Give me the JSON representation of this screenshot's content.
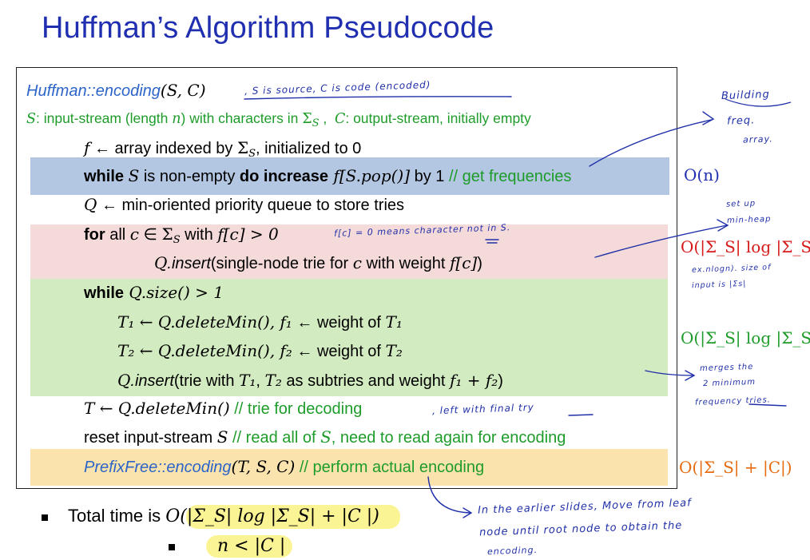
{
  "title": "Huffman’s Algorithm  Pseudocode",
  "code": {
    "header": {
      "name": "Huffman::encoding",
      "args": "(S, C)"
    },
    "params": {
      "s_label": "S",
      "s_desc_1": ": input-stream (length ",
      "n": "n",
      "s_desc_2": ") with characters in ",
      "sigma": "Σ",
      "sub_s": "S",
      "c_label": "C",
      "c_desc": ": output-stream, initially empty"
    },
    "line1": {
      "f": "f",
      "rest": " ← array indexed by ",
      "sigma": "Σ",
      "sub": "S",
      "tail": " initialized to 0"
    },
    "line2": {
      "kw1": "while",
      "S": "S",
      "mid": "  is non-empty ",
      "kw2": "do increase",
      "expr": " f[S.pop()]",
      "tail": " by 1 ",
      "comment": "// get frequencies"
    },
    "line3": {
      "Q": "Q",
      "rest": "  ← min-oriented priority queue to store tries"
    },
    "line4": {
      "kw": "for",
      "rest1": " all ",
      "c": "c",
      "in": "  ∈ ",
      "sigma": "Σ",
      "sub": "S",
      "with": " with ",
      "cond": "f[c] > 0"
    },
    "line5": {
      "Q": "Q",
      "method": ".insert",
      "rest": "(single-node trie for ",
      "c": "c",
      "rest2": " with weight ",
      "fc": "f[c]",
      "close": ")"
    },
    "line6": {
      "kw": "while",
      "expr": " Q.size() > 1"
    },
    "line7": {
      "lhs": "T₁ ← Q.deleteMin(), f₁",
      "rest": " ← weight of  ",
      "t": "T₁"
    },
    "line8": {
      "lhs": "T₂ ← Q.deleteMin(), f₂",
      "rest": " ← weight of  ",
      "t": "T₂"
    },
    "line9": {
      "Q": "Q",
      "method": ".insert",
      "rest": "(trie with ",
      "t1": "T₁",
      "comma": ", ",
      "t2": "T₂",
      "rest2": " as subtries and weight ",
      "sum": "f₁ + f₂",
      "close": ")"
    },
    "line10": {
      "expr": "T ← Q.deleteMin()",
      "comment": "  // trie for decoding"
    },
    "line11": {
      "text": "reset input-stream ",
      "S": "S",
      "comment1": "  // read all of ",
      "S2": "S",
      "comment2": ", need to read again for encoding"
    },
    "line12": {
      "name": "PrefixFree::encoding",
      "args": "(T, S, C)",
      "comment": " // perform actual encoding"
    }
  },
  "complexities": {
    "c1": "O(n)",
    "c2": "O(|Σ_S| log |Σ_S|)",
    "c3": "O(|Σ_S| log |Σ_S|)",
    "c4": "O(|Σ_S| + |C|)"
  },
  "total": {
    "label": "Total time  is ",
    "expr": "O(|Σ_S| log |Σ_S| + |C |)",
    "sub_expr": "n < |C |"
  },
  "handwriting": {
    "h1": ", S is source,  C is code  (encoded)",
    "h2_a": "Building",
    "h2_b": "freq.",
    "h2_c": "array.",
    "h3": "f[c] = 0   means character not  in  S.",
    "h4_a": "set up",
    "h4_b": "min-heap",
    "h5_a": "ex.nlogn). size of",
    "h5_b": "input  is |Σs|",
    "h6_a": "merges the",
    "h6_b": "2 minimum",
    "h6_c": "frequency tries.",
    "h7": ", left with final try",
    "h8_a": "In  the  earlier slides,  Move  from  leaf",
    "h8_b": "node  until  root  node  to  obtain  the",
    "h8_c": "encoding."
  },
  "colors": {
    "title": "#1f2fb0",
    "keyword_blue": "#2d64c8",
    "comment_green": "#1e9c2a",
    "complexity_red": "#d61a1a",
    "complexity_orange": "#e66b10",
    "band_blue": "#b3c6e2",
    "band_pink": "#f5dada",
    "band_green": "#d3ebc0",
    "band_yellow": "#fbe3ad",
    "highlight": "#fbf38a"
  }
}
